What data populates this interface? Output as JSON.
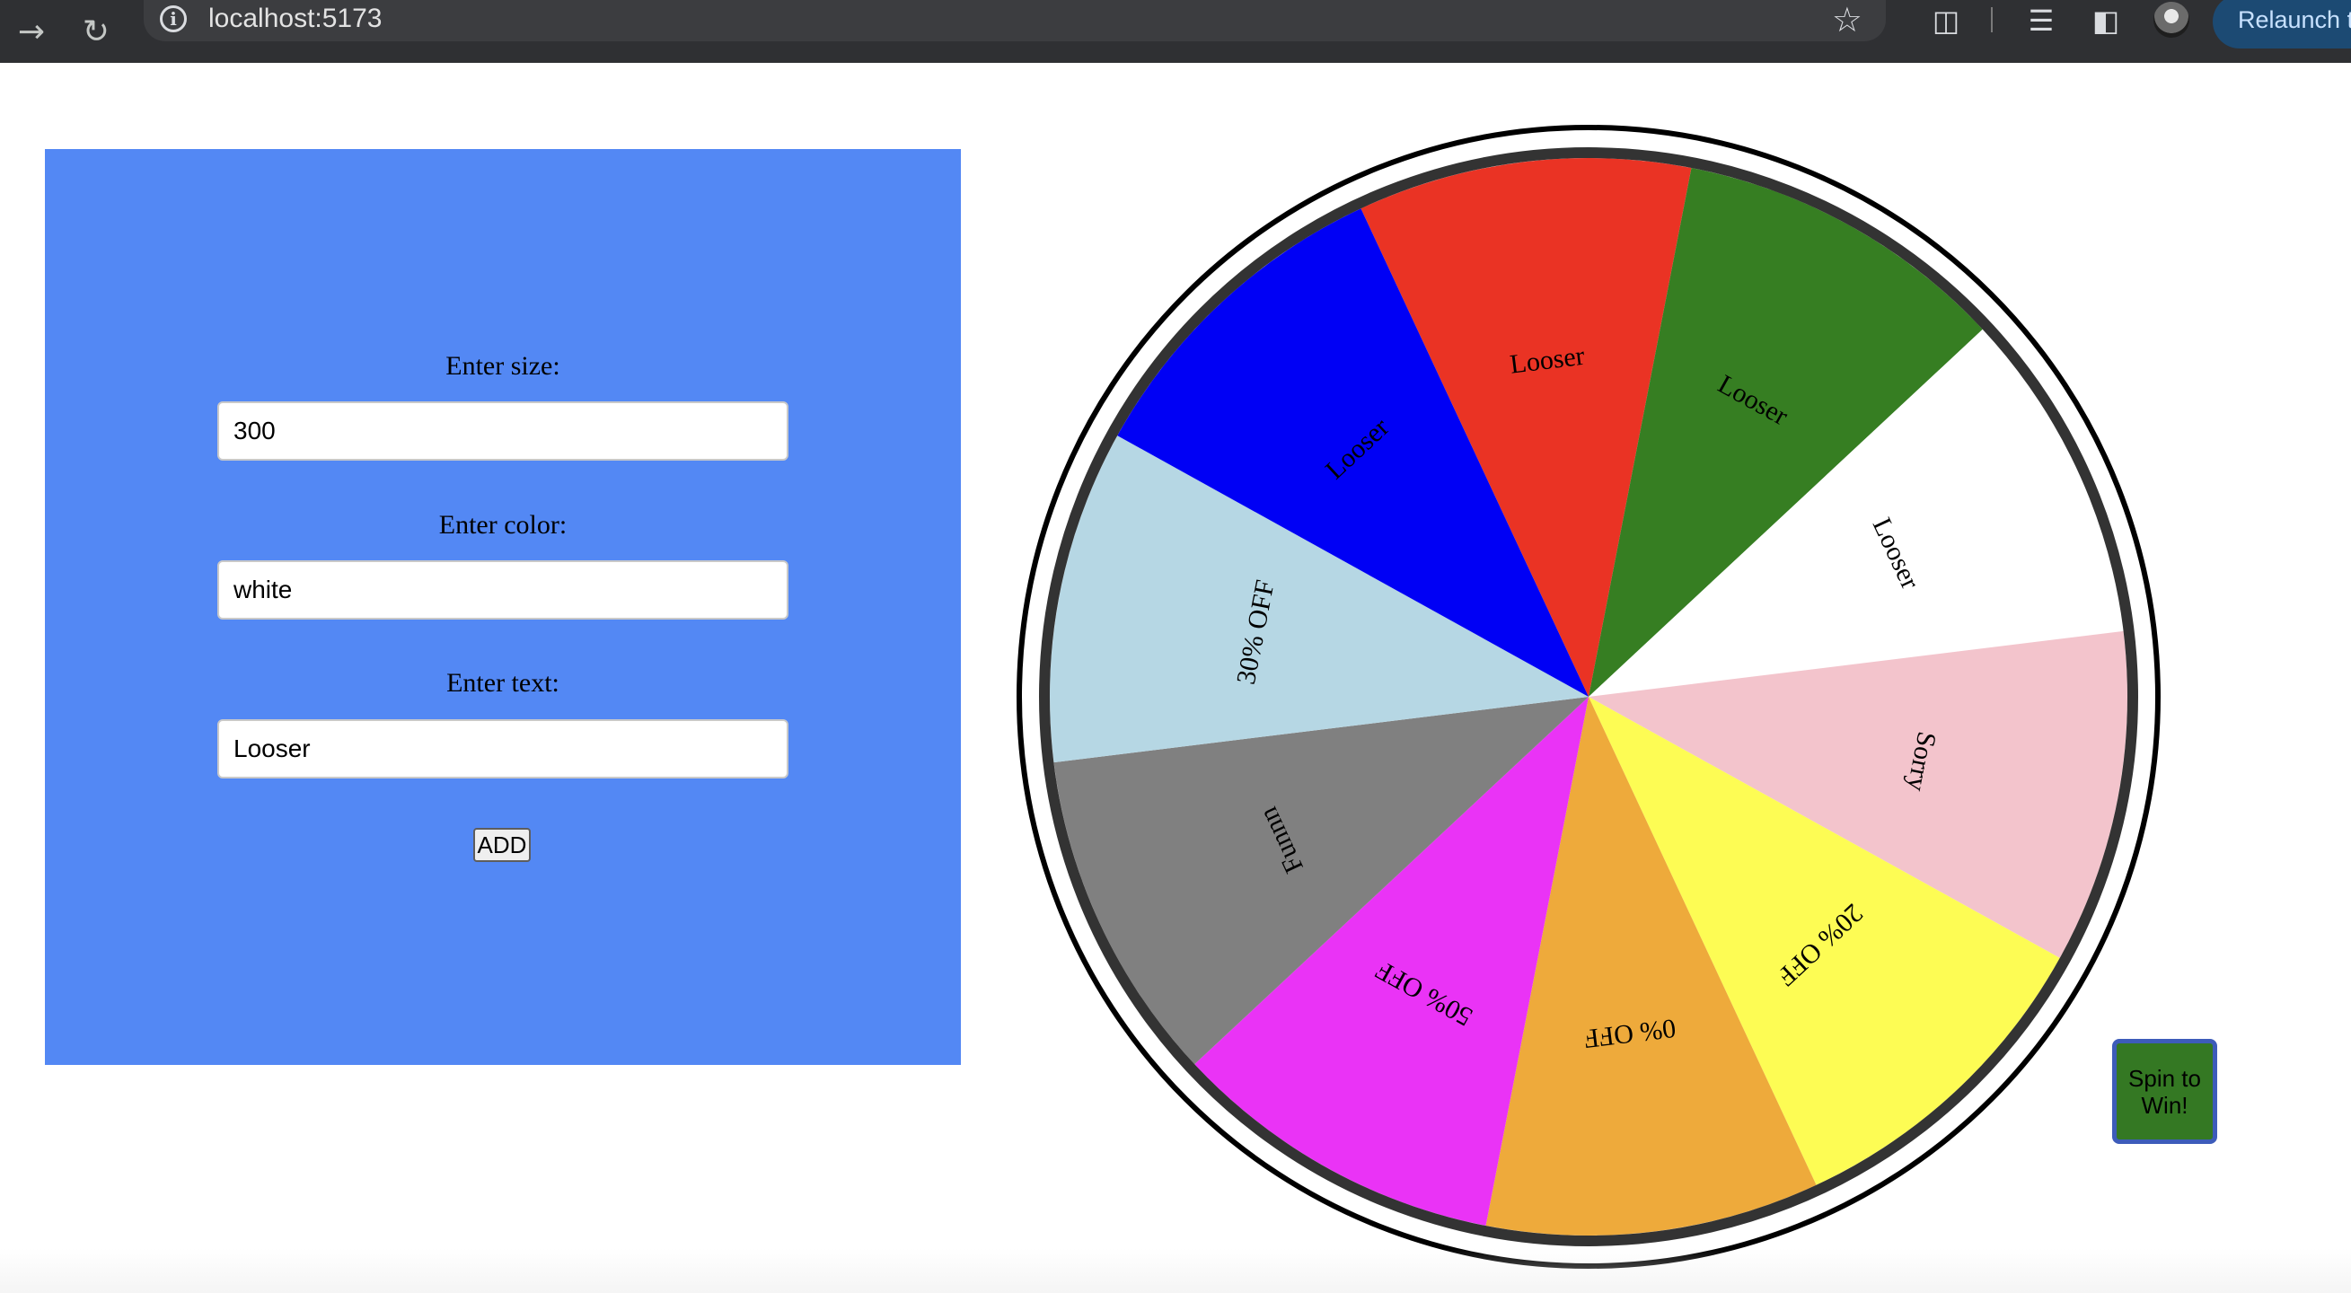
{
  "browser": {
    "url": "localhost:5173",
    "relaunch_label": "Relaunch t",
    "icons": {
      "forward": "arrow-right-icon",
      "reload": "reload-icon",
      "info": "info-icon",
      "bookmark": "star-icon",
      "extensions": "puzzle-icon",
      "media": "media-controls-icon",
      "side_panel": "side-panel-icon",
      "profile": "avatar"
    }
  },
  "form": {
    "background": "#5388f4",
    "size_label": "Enter size:",
    "size_value": "300",
    "color_label": "Enter color:",
    "color_value": "white",
    "text_label": "Enter text:",
    "text_value": "Looser",
    "add_label": "ADD"
  },
  "wheel": {
    "segments": [
      {
        "label": "Looser",
        "color": "#ea3324"
      },
      {
        "label": "Looser",
        "color": "#367e22"
      },
      {
        "label": "Looser",
        "color": "#ffffff"
      },
      {
        "label": "Sorry",
        "color": "#f3c4cc"
      },
      {
        "label": "20% OFF",
        "color": "#fdfc54"
      },
      {
        "label": "0% OFF",
        "color": "#eeaa3b"
      },
      {
        "label": "50% OFF",
        "color": "#ea33f6"
      },
      {
        "label": "Funnn",
        "color": "#808080"
      },
      {
        "label": "30% OFF",
        "color": "#b6d7e4"
      },
      {
        "label": "Looser",
        "color": "#0000f5"
      }
    ],
    "rim_color": "#333333",
    "spin_label": "Spin to Win!",
    "spin_color": "#347823"
  }
}
